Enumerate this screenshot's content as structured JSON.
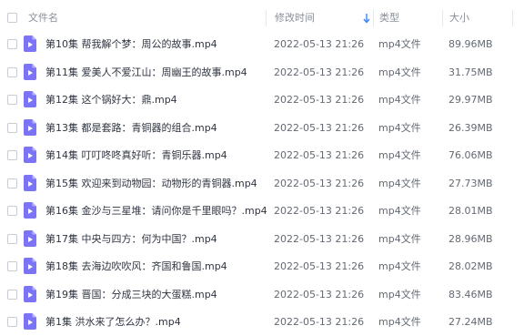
{
  "header": {
    "name_label": "文件名",
    "date_label": "修改时间",
    "type_label": "类型",
    "size_label": "大小",
    "sort_icon": "sort-down-arrow-icon",
    "sort_color": "#3a86ff"
  },
  "file_icon": {
    "name": "video-file-icon",
    "color": "#7b74f6"
  },
  "files": [
    {
      "name": "第10集 帮我解个梦：周公的故事.mp4",
      "date": "2022-05-13 21:26",
      "type": "mp4文件",
      "size": "89.96MB"
    },
    {
      "name": "第11集 爱美人不爱江山：周幽王的故事.mp4",
      "date": "2022-05-13 21:26",
      "type": "mp4文件",
      "size": "31.75MB"
    },
    {
      "name": "第12集 这个锅好大：鼎.mp4",
      "date": "2022-05-13 21:26",
      "type": "mp4文件",
      "size": "29.97MB"
    },
    {
      "name": "第13集 都是套路：青铜器的组合.mp4",
      "date": "2022-05-13 21:26",
      "type": "mp4文件",
      "size": "26.39MB"
    },
    {
      "name": "第14集 叮叮咚咚真好听：青铜乐器.mp4",
      "date": "2022-05-13 21:26",
      "type": "mp4文件",
      "size": "76.06MB"
    },
    {
      "name": "第15集 欢迎来到动物园：动物形的青铜器.mp4",
      "date": "2022-05-13 21:26",
      "type": "mp4文件",
      "size": "27.73MB"
    },
    {
      "name": "第16集 金沙与三星堆：请问你是千里眼吗？.mp4",
      "date": "2022-05-13 21:26",
      "type": "mp4文件",
      "size": "28.01MB"
    },
    {
      "name": "第17集 中央与四方：何为中国？.mp4",
      "date": "2022-05-13 21:26",
      "type": "mp4文件",
      "size": "28.96MB"
    },
    {
      "name": "第18集 去海边吹吹风：齐国和鲁国.mp4",
      "date": "2022-05-13 21:26",
      "type": "mp4文件",
      "size": "28.02MB"
    },
    {
      "name": "第19集 晋国：分成三块的大蛋糕.mp4",
      "date": "2022-05-13 21:26",
      "type": "mp4文件",
      "size": "83.46MB"
    },
    {
      "name": "第1集 洪水来了怎么办？.mp4",
      "date": "2022-05-13 21:26",
      "type": "mp4文件",
      "size": "27.24MB"
    }
  ]
}
